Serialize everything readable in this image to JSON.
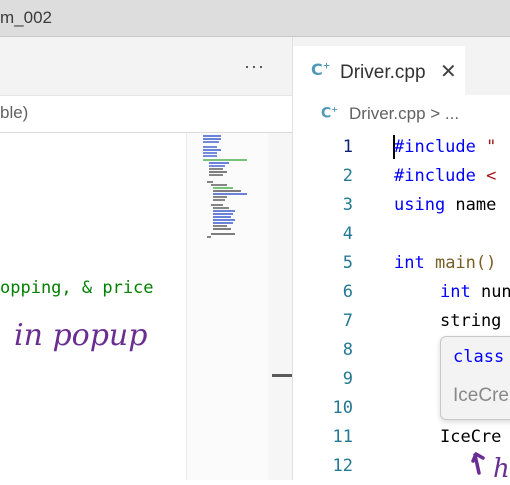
{
  "window": {
    "title_fragment": "m_002"
  },
  "left_pane": {
    "more_actions": "···",
    "breadcrumb_fragment": "ble)",
    "visible_code": "opping, & price",
    "annotation": "in popup"
  },
  "right_pane": {
    "tab": {
      "icon": "cpp-file-icon",
      "label": "Driver.cpp",
      "close": "✕"
    },
    "breadcrumb": {
      "file": "Driver.cpp",
      "rest": "> ..."
    },
    "line_numbers": [
      "1",
      "2",
      "3",
      "4",
      "5",
      "6",
      "7",
      "8",
      "9",
      "10",
      "11",
      "12"
    ],
    "code": {
      "l1_kw": "#include",
      "l1_rest": " \"",
      "l2_kw": "#include",
      "l2_rest": " <",
      "l3_kw": "using",
      "l3_rest": " name",
      "l5_kw": "int",
      "l5_rest": " main()",
      "l6_kw": "int",
      "l6_rest": " nun",
      "l7": "string",
      "l11": "IceCre"
    },
    "popup": {
      "line1": "class",
      "line2": "IceCre"
    },
    "annotation": "h"
  },
  "colors": {
    "keyword": "#0000ff",
    "line_number": "#237893",
    "ink": "#6a2d91",
    "comment_green": "#008000"
  }
}
